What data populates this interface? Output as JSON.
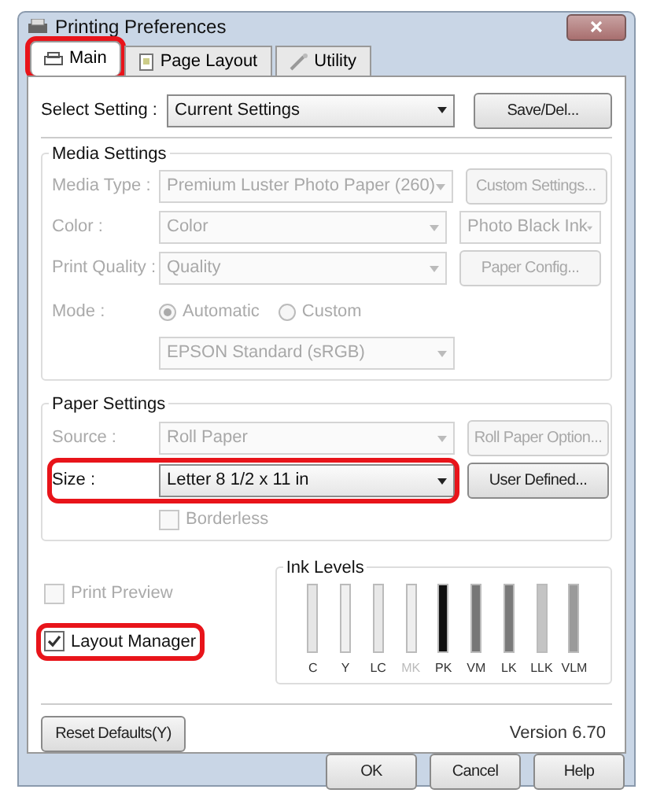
{
  "window": {
    "title": "Printing Preferences"
  },
  "tabs": [
    {
      "label": "Main",
      "selected": true,
      "highlighted": true
    },
    {
      "label": "Page Layout",
      "selected": false,
      "highlighted": false
    },
    {
      "label": "Utility",
      "selected": false,
      "highlighted": false
    }
  ],
  "select_setting": {
    "label": "Select Setting :",
    "value": "Current Settings",
    "button": "Save/Del..."
  },
  "media_settings": {
    "title": "Media Settings",
    "rows": [
      {
        "label": "Media Type :",
        "value": "Premium Luster Photo Paper (260)",
        "button": "Custom Settings...",
        "disabled": true
      },
      {
        "label": "Color :",
        "value": "Color",
        "side_select": "Photo Black Ink",
        "disabled": true
      },
      {
        "label": "Print Quality :",
        "value": "Quality",
        "button": "Paper Config...",
        "disabled": true
      }
    ],
    "mode": {
      "label": "Mode :",
      "options": [
        {
          "label": "Automatic",
          "selected": true
        },
        {
          "label": "Custom",
          "selected": false
        }
      ],
      "value": "EPSON Standard (sRGB)",
      "disabled": true
    }
  },
  "paper_settings": {
    "title": "Paper Settings",
    "rows": [
      {
        "label": "Source :",
        "value": "Roll Paper",
        "button": "Roll Paper Option...",
        "disabled": true,
        "highlighted": false
      },
      {
        "label": "Size :",
        "value": "Letter 8 1/2 x 11 in",
        "button": "User Defined...",
        "disabled": false,
        "highlighted": true
      }
    ],
    "borderless": {
      "label": "Borderless",
      "checked": false,
      "disabled": true
    }
  },
  "options": [
    {
      "label": "Print Preview",
      "checked": false,
      "disabled": true,
      "highlighted": false
    },
    {
      "label": "Layout Manager",
      "checked": true,
      "disabled": false,
      "highlighted": true
    }
  ],
  "ink_levels": {
    "title": "Ink Levels",
    "inks": [
      {
        "label": "C",
        "color": "#e6e6e6",
        "disabled": false
      },
      {
        "label": "Y",
        "color": "#f0f0f0",
        "disabled": false
      },
      {
        "label": "LC",
        "color": "#e8e8e8",
        "disabled": false
      },
      {
        "label": "MK",
        "color": "#eeeeee",
        "disabled": true
      },
      {
        "label": "PK",
        "color": "#111111",
        "disabled": false
      },
      {
        "label": "VM",
        "color": "#777777",
        "disabled": false
      },
      {
        "label": "LK",
        "color": "#7a7a7a",
        "disabled": false
      },
      {
        "label": "LLK",
        "color": "#c4c4c4",
        "disabled": false
      },
      {
        "label": "VLM",
        "color": "#9a9a9a",
        "disabled": false
      }
    ]
  },
  "reset_button": "Reset Defaults(Y)",
  "version": "Version 6.70",
  "buttons": [
    "OK",
    "Cancel",
    "Help"
  ]
}
